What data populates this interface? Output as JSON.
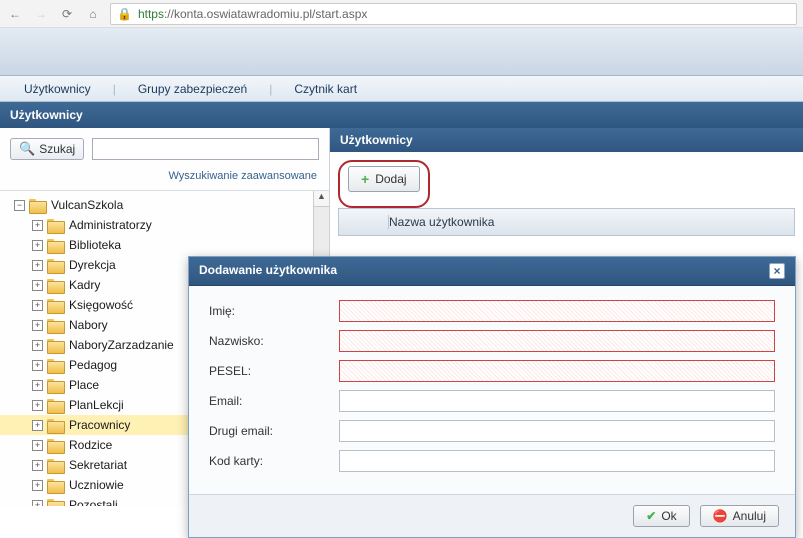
{
  "browser": {
    "url_scheme": "https",
    "url_rest": "://konta.oswiatawradomiu.pl/start.aspx"
  },
  "menu": {
    "item1": "Użytkownicy",
    "item2": "Grupy zabezpieczeń",
    "item3": "Czytnik kart"
  },
  "section_title": "Użytkownicy",
  "search": {
    "button": "Szukaj",
    "placeholder": "",
    "advanced": "Wyszukiwanie zaawansowane"
  },
  "tree": {
    "root": "VulcanSzkola",
    "items": [
      "Administratorzy",
      "Biblioteka",
      "Dyrekcja",
      "Kadry",
      "Księgowość",
      "Nabory",
      "NaboryZarzadzanie",
      "Pedagog",
      "Place",
      "PlanLekcji",
      "Pracownicy",
      "Rodzice",
      "Sekretariat",
      "Uczniowie",
      "Pozostali"
    ],
    "highlight_index": 10
  },
  "right": {
    "title": "Użytkownicy",
    "add": "Dodaj",
    "col": "Nazwa użytkownika"
  },
  "modal": {
    "title": "Dodawanie użytkownika",
    "fields": {
      "imie": "Imię:",
      "nazwisko": "Nazwisko:",
      "pesel": "PESEL:",
      "email": "Email:",
      "email2": "Drugi email:",
      "kod": "Kod karty:"
    },
    "ok": "Ok",
    "cancel": "Anuluj"
  }
}
